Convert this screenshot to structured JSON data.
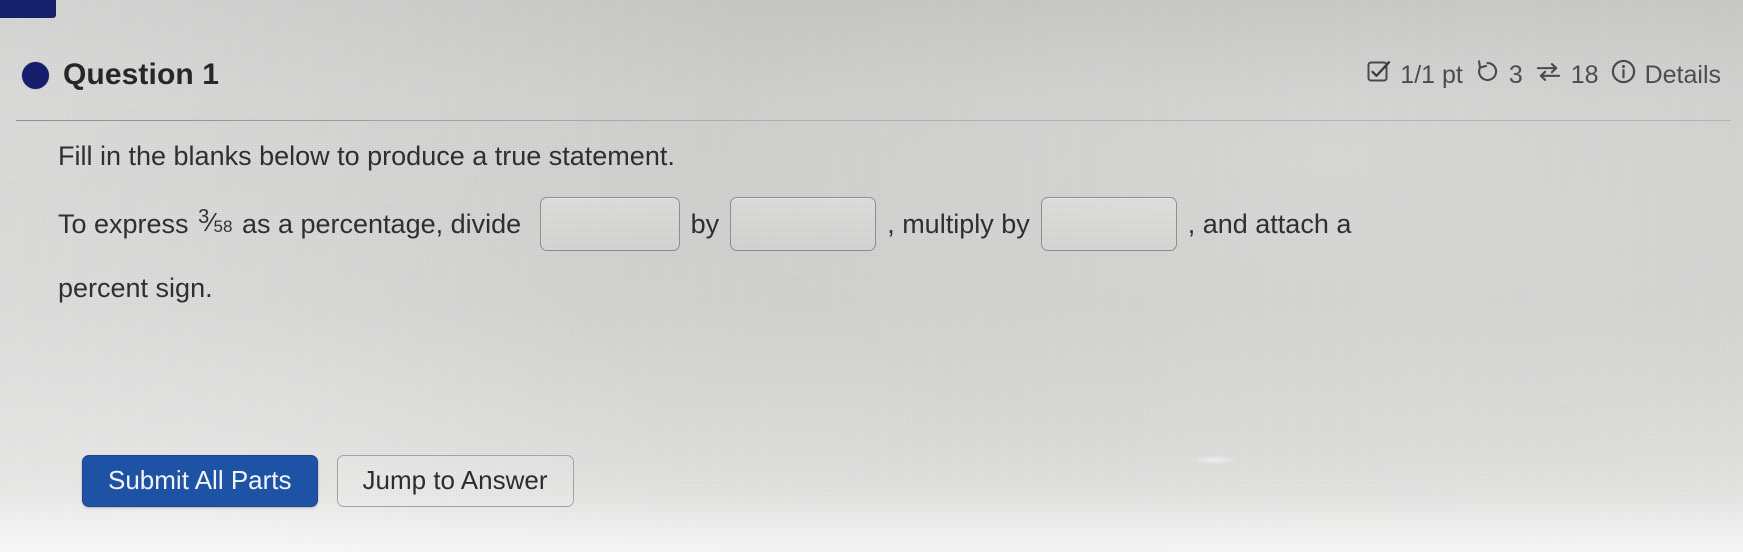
{
  "header": {
    "status_dot_color": "#151f6d",
    "title": "Question 1",
    "points": "1/1 pt",
    "attempts_count": "3",
    "versions_count": "18",
    "details_label": "Details",
    "icons": {
      "score": "checked-checkbox-icon",
      "attempts": "undo-circular-arrow-icon",
      "versions": "swap-arrows-icon",
      "details": "info-circle-icon"
    }
  },
  "body": {
    "instruction": "Fill in the blanks below to produce a true statement.",
    "statement": {
      "prefix": "To express ",
      "fraction": {
        "numerator": "3",
        "slash": "⁄",
        "denominator": "58"
      },
      "after_fraction": " as a percentage, divide ",
      "between_1_2": "by",
      "between_2_3": ", multiply by",
      "after_box_3": ", and attach a",
      "tail": "percent sign."
    },
    "answer_boxes": [
      {
        "name": "blank-1",
        "value": "",
        "placeholder": ""
      },
      {
        "name": "blank-2",
        "value": "",
        "placeholder": ""
      },
      {
        "name": "blank-3",
        "value": "",
        "placeholder": ""
      }
    ]
  },
  "buttons": {
    "submit_label": "Submit All Parts",
    "submit_color": "#1d52a5",
    "jump_label": "Jump to Answer"
  }
}
